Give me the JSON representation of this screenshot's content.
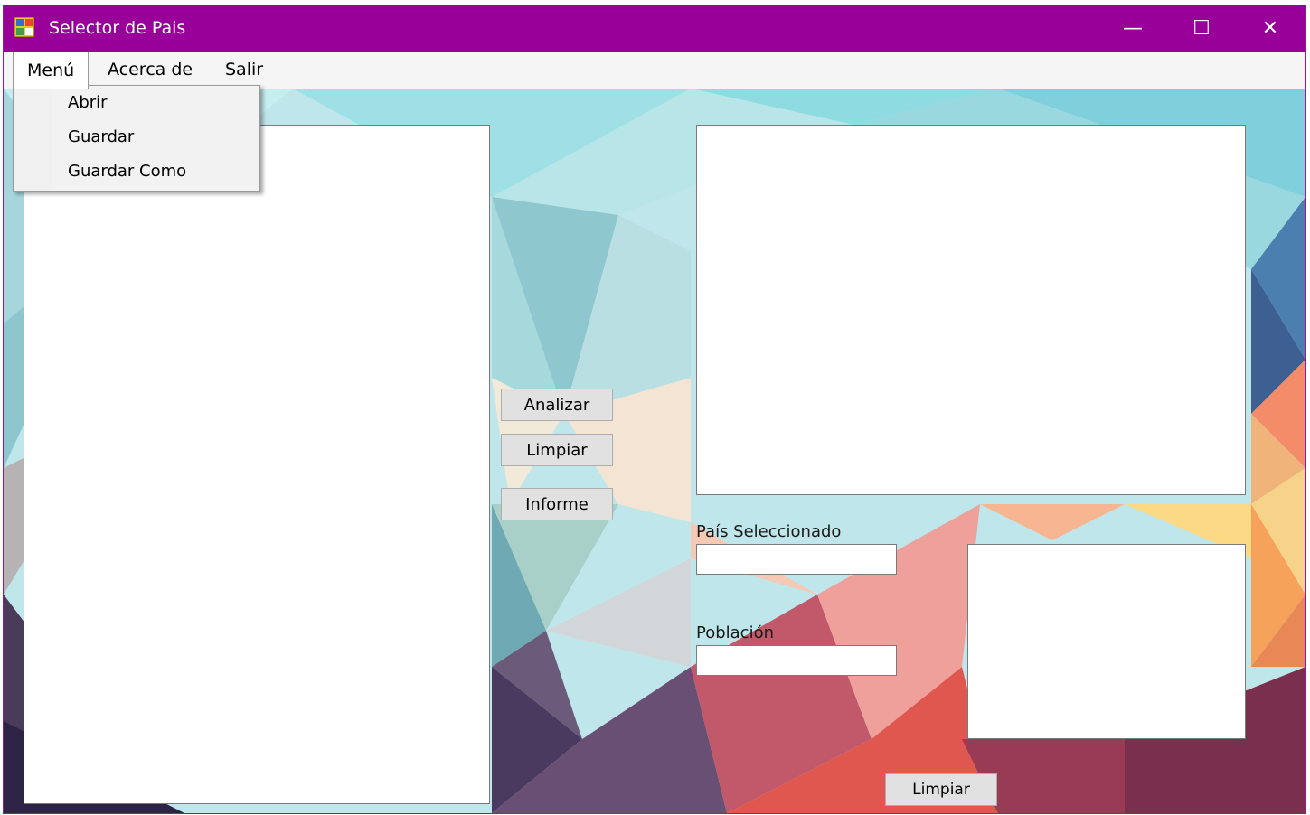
{
  "window": {
    "title": "Selector de Pais",
    "accent_color": "#990099",
    "controls": {
      "minimize": "—",
      "maximize": "☐",
      "close": "✕"
    }
  },
  "menubar": {
    "items": [
      {
        "label": "Menú"
      },
      {
        "label": "Acerca de"
      },
      {
        "label": "Salir"
      }
    ]
  },
  "dropdown": {
    "items": [
      {
        "label": "Abrir"
      },
      {
        "label": "Guardar"
      },
      {
        "label": "Guardar Como"
      }
    ]
  },
  "buttons": {
    "analizar": "Analizar",
    "limpiar_top": "Limpiar",
    "informe": "Informe",
    "limpiar_bottom": "Limpiar"
  },
  "fields": {
    "pais_label": "País Seleccionado",
    "pais_value": "",
    "poblacion_label": "Población",
    "poblacion_value": ""
  }
}
